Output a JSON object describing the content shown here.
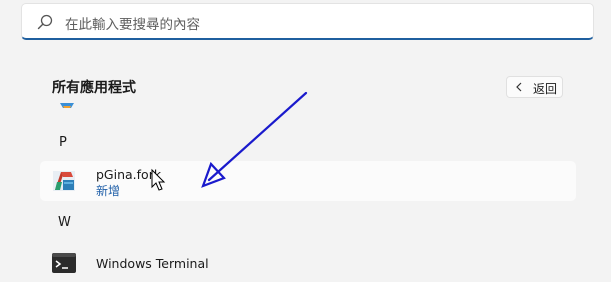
{
  "search": {
    "placeholder": "在此輸入要搜尋的內容",
    "icon": "search-icon"
  },
  "section": {
    "title": "所有應用程式",
    "back_label": "返回",
    "back_icon": "chevron-left-icon"
  },
  "groups": [
    {
      "letter": "P",
      "apps": [
        {
          "name": "pGina.fork",
          "subtitle": "新增",
          "icon": "pgina-app-icon"
        }
      ]
    },
    {
      "letter": "W",
      "apps": [
        {
          "name": "Windows Terminal",
          "icon": "terminal-app-icon"
        }
      ]
    }
  ],
  "colors": {
    "accent": "#1f5f9f",
    "link": "#1f5fa8",
    "annotation_arrow": "#1a1acc",
    "background": "#f3f3f3"
  }
}
